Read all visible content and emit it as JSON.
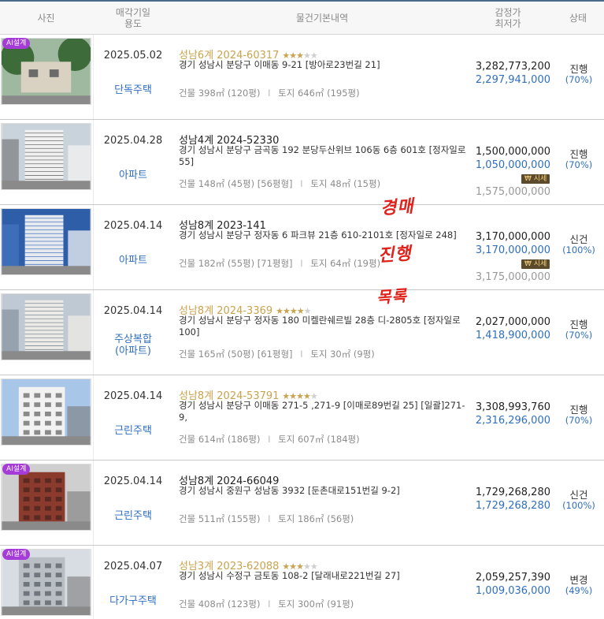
{
  "header": {
    "photo": "사진",
    "date_line1": "매각기일",
    "date_line2": "용도",
    "info": "물건기본내역",
    "price_line1": "감정가",
    "price_line2": "최저가",
    "status": "상태"
  },
  "labels": {
    "ai_badge": "AI설계",
    "market_badge": "시세",
    "building_prefix": "건물",
    "land_prefix": "토지",
    "separator": "I"
  },
  "annotations": [
    "경매",
    "진행",
    "목록"
  ],
  "colors": {
    "accent_blue": "#2f6fbf",
    "gold": "#c9a34e",
    "ai_purple": "#a63cd8",
    "annotation_red": "#e0211c"
  },
  "items": [
    {
      "ai": true,
      "date": "2025.05.02",
      "kind": "단독주택",
      "case": "성남6계 2024-60317",
      "case_color": "gold",
      "stars": 3,
      "address": "경기 성남시 분당구 이매동 9-21 [방아로23번길 21]",
      "building": "398㎡ (120평)",
      "land": "646㎡ (195평)",
      "appraisal": "3,282,773,200",
      "minimum": "2,297,941,000",
      "market": false,
      "market_price": "",
      "status": "진행",
      "percent": "(70%)"
    },
    {
      "ai": false,
      "date": "2025.04.28",
      "kind": "아파트",
      "case": "성남4계 2024-52330",
      "case_color": "black",
      "stars": 0,
      "address": "경기 성남시 분당구 금곡동 192 분당두산위브 106동 6층 601호 [정자일로 55]",
      "building": "148㎡ (45평) [56평형]",
      "land": "48㎡ (15평)",
      "appraisal": "1,500,000,000",
      "minimum": "1,050,000,000",
      "market": true,
      "market_price": "1,575,000,000",
      "status": "진행",
      "percent": "(70%)"
    },
    {
      "ai": false,
      "date": "2025.04.14",
      "kind": "아파트",
      "case": "성남8계 2023-141",
      "case_color": "black",
      "stars": 0,
      "address": "경기 성남시 분당구 정자동 6 파크뷰 21층 610-2101호 [정자일로 248]",
      "building": "182㎡ (55평) [71평형]",
      "land": "64㎡ (19평)",
      "appraisal": "3,170,000,000",
      "minimum": "3,170,000,000",
      "market": true,
      "market_price": "3,175,000,000",
      "status": "신건",
      "percent": "(100%)"
    },
    {
      "ai": false,
      "date": "2025.04.14",
      "kind": "주상복합\n(아파트)",
      "case": "성남8계 2024-3369",
      "case_color": "gold",
      "stars": 4,
      "address": "경기 성남시 분당구 정자동 180 미켈란쉐르빌 28층 디-2805호 [정자일로 100]",
      "building": "165㎡ (50평) [61평형]",
      "land": "30㎡ (9평)",
      "appraisal": "2,027,000,000",
      "minimum": "1,418,900,000",
      "market": false,
      "market_price": "",
      "status": "진행",
      "percent": "(70%)"
    },
    {
      "ai": false,
      "date": "2025.04.14",
      "kind": "근린주택",
      "case": "성남8계 2024-53791",
      "case_color": "gold",
      "stars": 4,
      "address": "경기 성남시 분당구 이매동 271-5 ,271-9 [이매로89번길 25] [일괄]271-9,",
      "building": "614㎡ (186평)",
      "land": "607㎡ (184평)",
      "appraisal": "3,308,993,760",
      "minimum": "2,316,296,000",
      "market": false,
      "market_price": "",
      "status": "진행",
      "percent": "(70%)"
    },
    {
      "ai": true,
      "date": "2025.04.14",
      "kind": "근린주택",
      "case": "성남8계 2024-66049",
      "case_color": "black",
      "stars": 0,
      "address": "경기 성남시 중원구 성남동 3932 [둔촌대로151번길 9-2]",
      "building": "511㎡ (155평)",
      "land": "186㎡ (56평)",
      "appraisal": "1,729,268,280",
      "minimum": "1,729,268,280",
      "market": false,
      "market_price": "",
      "status": "신건",
      "percent": "(100%)"
    },
    {
      "ai": true,
      "date": "2025.04.07",
      "kind": "다가구주택",
      "case": "성남3계 2023-62088",
      "case_color": "gold",
      "stars": 3,
      "address": "경기 성남시 수정구 금토동 108-2 [달래내로221번길 27]",
      "building": "408㎡ (123평)",
      "land": "300㎡ (91평)",
      "appraisal": "2,059,257,390",
      "minimum": "1,009,036,000",
      "market": false,
      "market_price": "",
      "status": "변경",
      "percent": "(49%)"
    }
  ]
}
